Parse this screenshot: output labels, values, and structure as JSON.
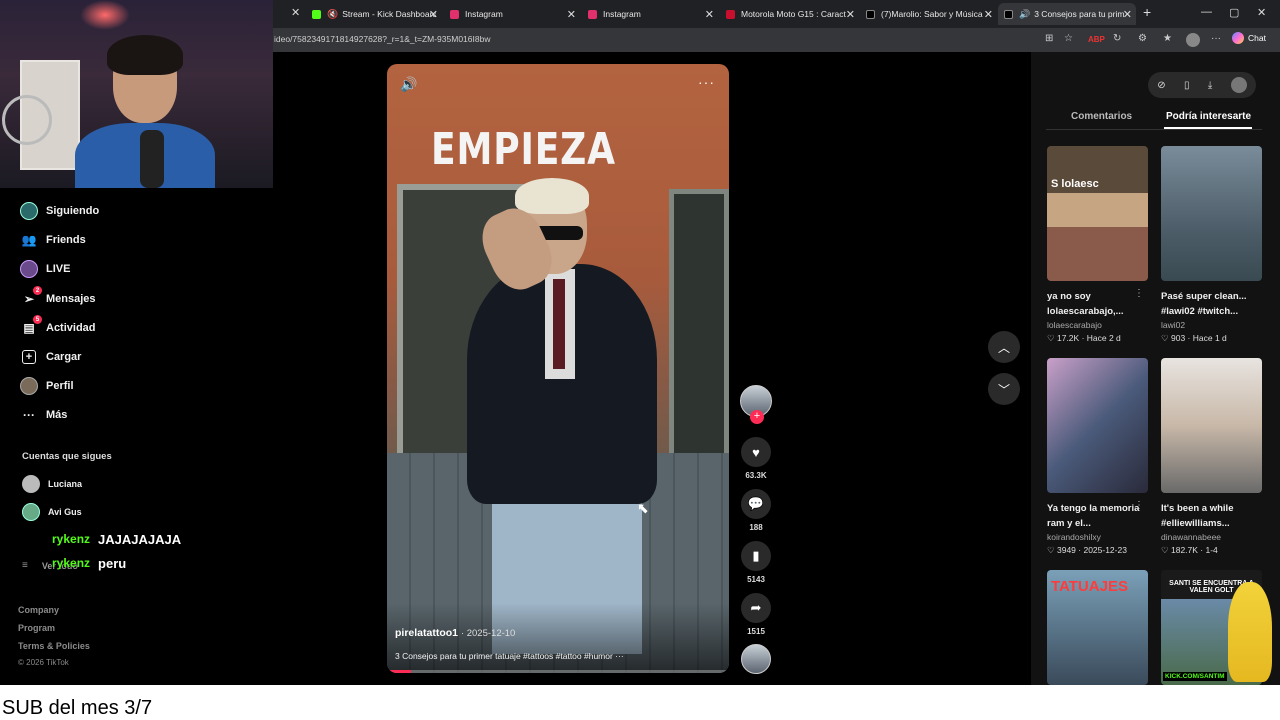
{
  "tabs": [
    {
      "label": "Stream - Kick Dashboard",
      "fav": "#53fc18"
    },
    {
      "label": "Instagram",
      "fav": "#e1306c"
    },
    {
      "label": "Instagram",
      "fav": "#e1306c"
    },
    {
      "label": "Motorola Moto G15 : Caract",
      "fav": "#c8102e"
    },
    {
      "label": "(7)Marolio: Sabor y Música",
      "fav": "#000000"
    },
    {
      "label": "3 Consejos para tu prim",
      "fav": "#000000"
    }
  ],
  "browser": {
    "url": "ideo/7582349171814927628?_r=1&_t=ZM-935M016I8bw",
    "chat_label": "Chat"
  },
  "nav": [
    {
      "label": "Siguiendo",
      "icon": "following-icon"
    },
    {
      "label": "Friends",
      "icon": "friends-icon"
    },
    {
      "label": "LIVE",
      "icon": "live-icon"
    },
    {
      "label": "Mensajes",
      "icon": "messages-icon",
      "badge": "2"
    },
    {
      "label": "Actividad",
      "icon": "activity-icon",
      "badge": "5"
    },
    {
      "label": "Cargar",
      "icon": "upload-icon"
    },
    {
      "label": "Perfil",
      "icon": "profile-icon"
    },
    {
      "label": "Más",
      "icon": "more-icon"
    }
  ],
  "following": {
    "title": "Cuentas que sigues",
    "accounts": [
      "Luciana",
      "Avi Gus"
    ],
    "see_all": "Ver todo"
  },
  "chat_overlay": [
    {
      "user": "rykenz",
      "message": "JAJAJAJAJA"
    },
    {
      "user": "rykenz",
      "message": "peru"
    }
  ],
  "footer": {
    "links": [
      "Company",
      "Program",
      "Terms & Policies"
    ],
    "copyright": "© 2026 TikTok"
  },
  "video": {
    "overlay_text": "EMPIEZA",
    "author": "pirelatattoo1",
    "date": "· 2025-12-10",
    "description": "3 Consejos para tu primer tatuaje #tattoos #tattoo #humor ···",
    "progress": 0.07
  },
  "actions": {
    "likes": "63.3K",
    "comments": "188",
    "saves": "5143",
    "shares": "1515"
  },
  "right_panel": {
    "tab_comments": "Comentarios",
    "tab_suggested": "Podría interesarte",
    "cards": [
      {
        "title": "ya no soy lolaescarabajo,...",
        "user": "lolaescarabajo",
        "likes": "17.2K",
        "time": "Hace 2 d"
      },
      {
        "title": "Pasé super clean... #lawi02 #twitch...",
        "user": "lawi02",
        "likes": "903",
        "time": "Hace 1 d"
      },
      {
        "title": "Ya tengo la memoria ram y el...",
        "user": "koirandoshilxy",
        "likes": "3949",
        "time": "2025-12-23"
      },
      {
        "title": "It's been a while #elliewilliams...",
        "user": "dinawannabeee",
        "likes": "182.7K",
        "time": "1-4"
      }
    ],
    "thumb_texts": {
      "card1": "S lolaesc",
      "card5": "TATUAJES",
      "card6_caption": "SANTI SE ENCUENTRA A VALEN GOLT",
      "card6_tag": "KICK.COM/SANTIM"
    }
  },
  "stream_overlay": {
    "sub_text": "SUB del mes 3/7"
  },
  "colors": {
    "accent": "#fe2c55",
    "kick_green": "#53fc18"
  }
}
